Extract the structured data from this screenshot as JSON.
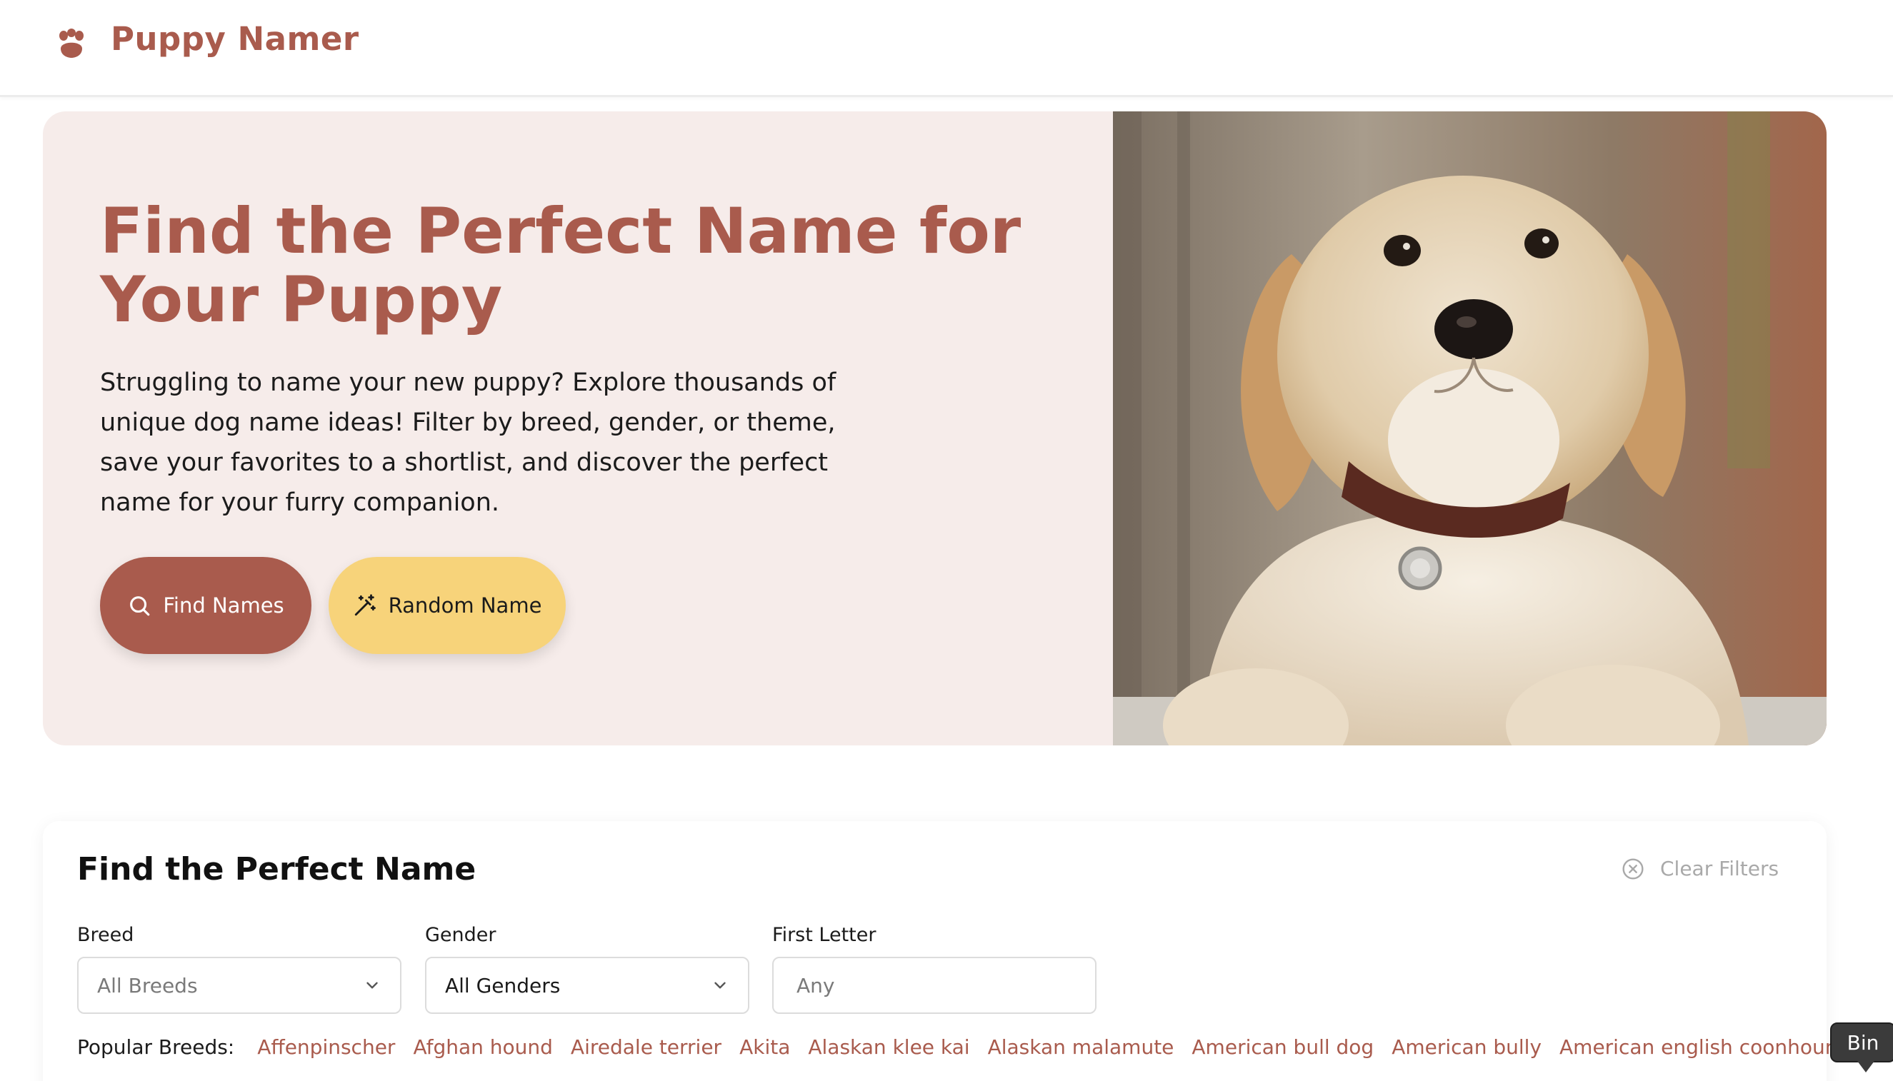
{
  "app": {
    "name": "Puppy Namer",
    "brand_color": "#a95b4d",
    "accent_color": "#f7d37a",
    "hero_bg": "#f6ecea"
  },
  "header": {
    "logo_icon": "paw-icon",
    "title": "Puppy Namer"
  },
  "hero": {
    "title": "Find the Perfect Name for Your Puppy",
    "description": "Struggling to name your new puppy? Explore thousands of unique dog name ideas! Filter by breed, gender, or theme, save your favorites to a shortlist, and discover the perfect name for your furry companion.",
    "buttons": [
      {
        "label": "Find Names",
        "icon": "search-icon"
      },
      {
        "label": "Random Name",
        "icon": "magic-wand-icon"
      }
    ],
    "image": "golden-retriever-puppy-photo"
  },
  "finder": {
    "title": "Find the Perfect Name",
    "clear_filters": "Clear Filters",
    "filters": {
      "breed": {
        "label": "Breed",
        "value": "All Breeds"
      },
      "gender": {
        "label": "Gender",
        "value": "All Genders"
      },
      "first_letter": {
        "label": "First Letter",
        "placeholder": "Any"
      }
    },
    "popular_label": "Popular Breeds:",
    "popular_breeds": [
      "Affenpinscher",
      "Afghan hound",
      "Airedale terrier",
      "Akita",
      "Alaskan klee kai",
      "Alaskan malamute",
      "American bull dog",
      "American bully",
      "American english coonhound"
    ]
  },
  "tooltip": {
    "text": "Bin"
  }
}
